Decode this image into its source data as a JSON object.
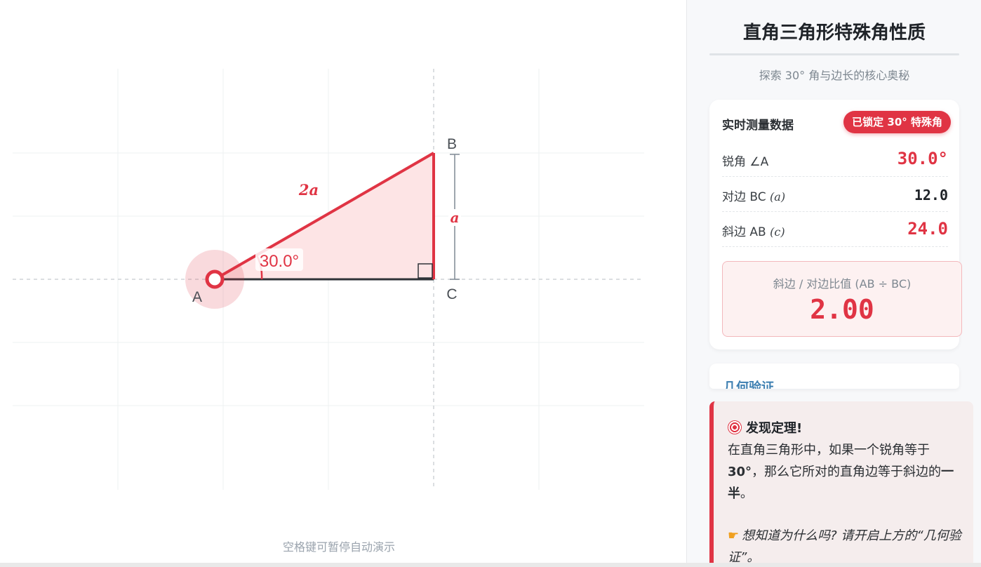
{
  "canvas": {
    "vertex_a": "A",
    "vertex_b": "B",
    "vertex_c": "C",
    "hypotenuse_label": "2a",
    "opposite_label": "a",
    "angle_label": "30.0°",
    "hint": "空格键可暂停自动演示"
  },
  "panel": {
    "title": "直角三角形特殊角性质",
    "subtitle": "探索 30° 角与边长的核心奥秘",
    "measure": {
      "heading": "实时测量数据",
      "badge": "已锁定 30° 特殊角",
      "angle_label": "锐角 ∠A",
      "angle_value": "30.0°",
      "opposite_label": "对边 BC",
      "opposite_var": "(a)",
      "opposite_value": "12.0",
      "hypotenuse_label": "斜边 AB",
      "hypotenuse_var": "(c)",
      "hypotenuse_value": "24.0",
      "ratio_label": "斜边 / 对边比值 (AB ÷ BC)",
      "ratio_value": "2.00"
    },
    "proof_heading": "几何验证",
    "note": {
      "heading": "发现定理!",
      "body_1": "在直角三角形中，如果一个锐角等于",
      "body_bold": "30°",
      "body_2": "，那么它所对的直角边等于斜边的",
      "body_bold_2": "一半",
      "body_3": "。",
      "tip": "想知道为什么吗? 请开启上方的“几何验证”。"
    }
  },
  "colors": {
    "accent": "#e03444",
    "fill": "#fde4e5",
    "link": "#3d7fb1"
  }
}
